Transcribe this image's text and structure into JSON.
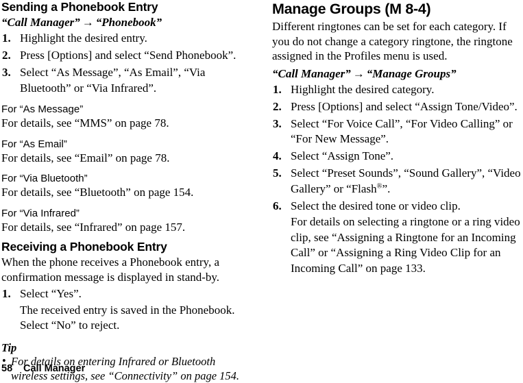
{
  "page": {
    "number": "58",
    "chapter": "Call Manager"
  },
  "left_column": {
    "heading": "Sending a Phonebook Entry",
    "breadcrumb": {
      "from": "“Call Manager”",
      "arrow": "→",
      "to": "“Phonebook”"
    },
    "steps": [
      {
        "num": "1.",
        "text": "Highlight the desired entry."
      },
      {
        "num": "2.",
        "text": "Press [Options] and select “Send Phonebook”."
      },
      {
        "num": "3.",
        "text": "Select “As Message”, “As Email”, “Via Bluetooth” or “Via Infrared”."
      }
    ],
    "subsections": [
      {
        "heading": "For “As Message”",
        "body": "For details, see “MMS” on page 78."
      },
      {
        "heading": "For “As Email”",
        "body": "For details, see “Email” on page 78."
      },
      {
        "heading": "For “Via Bluetooth”",
        "body": "For details, see “Bluetooth” on page 154."
      },
      {
        "heading": "For “Via Infrared”",
        "body": "For details, see “Infrared” on page 157."
      }
    ],
    "receiving": {
      "heading": "Receiving a Phonebook Entry",
      "intro": "When the phone receives a Phonebook entry, a confirmation message is displayed in stand-by.",
      "step_num": "1.",
      "step_text": "Select “Yes”.",
      "step_note": "The received entry is saved in the Phonebook. Select “No” to reject."
    },
    "tip": {
      "title": "Tip",
      "bullet": "•",
      "text": "For details on entering Infrared or Bluetooth wireless settings, see “Connectivity” on page 154."
    }
  },
  "right_column": {
    "heading": "Manage Groups (M 8-4)",
    "intro": "Different ringtones can be set for each category. If you do not change a category ringtone, the ringtone assigned in the Profiles menu is used.",
    "breadcrumb": {
      "from": "“Call Manager”",
      "arrow": "→",
      "to": "“Manage Groups”"
    },
    "steps": [
      {
        "num": "1.",
        "text": "Highlight the desired category.",
        "note": ""
      },
      {
        "num": "2.",
        "text": "Press [Options] and select “Assign Tone/Video”.",
        "note": ""
      },
      {
        "num": "3.",
        "text": "Select “For Voice Call”, “For Video Calling” or “For New Message”.",
        "note": ""
      },
      {
        "num": "4.",
        "text": "Select “Assign Tone”.",
        "note": ""
      },
      {
        "num": "5.",
        "text_pre": "Select “Preset Sounds”, “Sound Gallery”, “Video Gallery” or “Flash",
        "superscript": "®",
        "text_post": "”.",
        "note": ""
      },
      {
        "num": "6.",
        "text": "Select the desired tone or video clip.",
        "note": "For details on selecting a ringtone or a ring video clip, see “Assigning a Ringtone for an Incoming Call” or “Assigning a Ring Video Clip for an Incoming Call” on page 133."
      }
    ]
  }
}
